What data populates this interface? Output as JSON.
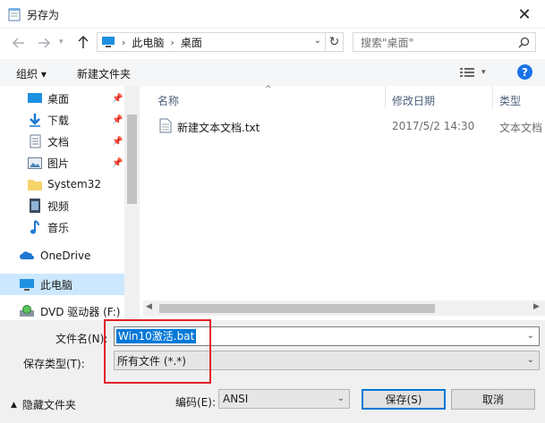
{
  "window": {
    "title": "另存为",
    "close_glyph": "✕"
  },
  "address": {
    "crumbs": [
      "此电脑",
      "桌面"
    ],
    "search_placeholder": "搜索\"桌面\""
  },
  "toolbar": {
    "organize": "组织 ▾",
    "new_folder": "新建文件夹",
    "help": "?"
  },
  "nav": {
    "items": [
      {
        "label": "桌面",
        "icon": "desktop-icon",
        "pinned": true
      },
      {
        "label": "下载",
        "icon": "download-icon",
        "pinned": true
      },
      {
        "label": "文档",
        "icon": "document-icon",
        "pinned": true
      },
      {
        "label": "图片",
        "icon": "picture-icon",
        "pinned": true
      },
      {
        "label": "System32",
        "icon": "folder-icon",
        "pinned": false
      },
      {
        "label": "视频",
        "icon": "video-icon",
        "pinned": false
      },
      {
        "label": "音乐",
        "icon": "music-icon",
        "pinned": false
      },
      {
        "label": "OneDrive",
        "icon": "cloud-icon",
        "pinned": false
      },
      {
        "label": "此电脑",
        "icon": "pc-icon",
        "pinned": false,
        "selected": true
      },
      {
        "label": "DVD 驱动器 (F:) (",
        "icon": "dvd-icon",
        "pinned": false
      }
    ]
  },
  "files": {
    "columns": [
      "名称",
      "修改日期",
      "类型"
    ],
    "rows": [
      {
        "name": "新建文本文档.txt",
        "date": "2017/5/2 14:30",
        "type": "文本文档"
      }
    ]
  },
  "form": {
    "filename_label": "文件名(N):",
    "filename_value": "Win10激活.bat",
    "filetype_label": "保存类型(T):",
    "filetype_value": "所有文件  (*.*)",
    "hide_folders": "隐藏文件夹",
    "encoding_label": "编码(E):",
    "encoding_value": "ANSI",
    "save_label": "保存(S)",
    "cancel_label": "取消"
  },
  "colors": {
    "accent": "#0078d7",
    "selection": "#cce8ff",
    "highlight_box": "#e0202a"
  }
}
